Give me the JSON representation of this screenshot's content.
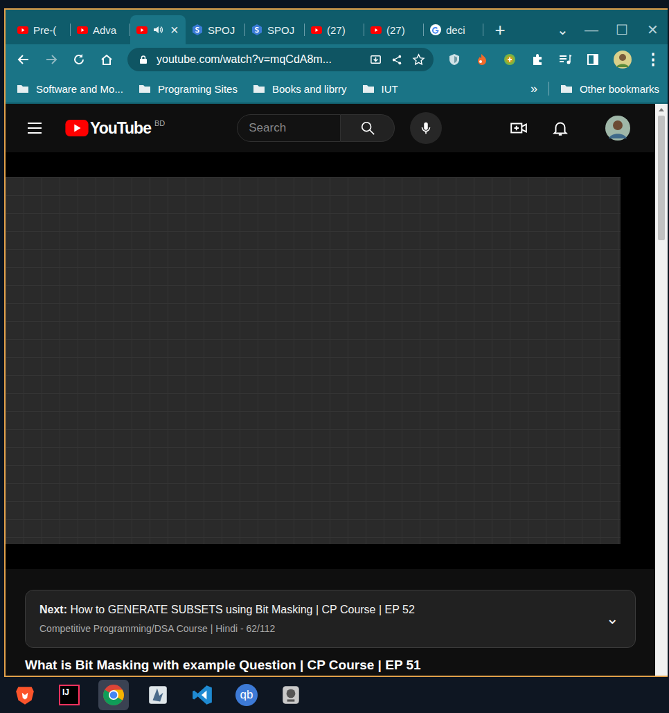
{
  "tabs": [
    {
      "label": "Pre-(",
      "icon": "youtube",
      "selected": false,
      "audio": false
    },
    {
      "label": "Adva",
      "icon": "youtube",
      "selected": false,
      "audio": false
    },
    {
      "label": "",
      "icon": "youtube",
      "selected": true,
      "audio": true
    },
    {
      "label": "SPOJ",
      "icon": "spoj",
      "selected": false,
      "audio": false
    },
    {
      "label": "SPOJ",
      "icon": "spoj",
      "selected": false,
      "audio": false
    },
    {
      "label": "(27)",
      "icon": "youtube",
      "selected": false,
      "audio": false
    },
    {
      "label": "(27)",
      "icon": "youtube",
      "selected": false,
      "audio": false
    },
    {
      "label": "deci",
      "icon": "google",
      "selected": false,
      "audio": false
    }
  ],
  "tab_close": "×",
  "tab_controls": {
    "new_tab": "+",
    "dropdown": "⌄",
    "minimize": "—",
    "maximize": "☐",
    "close": "✕"
  },
  "address": {
    "url": "youtube.com/watch?v=mqCdA8m..."
  },
  "menu": "⋮",
  "bookmarks": [
    "Software and Mo...",
    "Programing Sites",
    "Books and librry",
    "IUT"
  ],
  "bookmarks_overflow": "»",
  "other_bookmarks": "Other bookmarks",
  "youtube": {
    "logo": "YouTube",
    "region": "BD",
    "search_placeholder": "Search"
  },
  "up_next": {
    "label": "Next:",
    "title": "How to GENERATE SUBSETS using Bit Masking | CP Course | EP 52",
    "playlist": "Competitive Programming/DSA Course | Hindi - 62/112",
    "chevron": "⌄"
  },
  "video_title": "What is Bit Masking with example Question | CP Course | EP 51",
  "taskbar": [
    {
      "kind": "brave",
      "label": "",
      "selected": false
    },
    {
      "kind": "intellij",
      "label": "IJ",
      "selected": false
    },
    {
      "kind": "chrome",
      "label": "",
      "selected": true
    },
    {
      "kind": "app",
      "label": "",
      "selected": false
    },
    {
      "kind": "vscode",
      "label": "",
      "selected": false
    },
    {
      "kind": "qbittorrent",
      "label": "qb",
      "selected": false
    },
    {
      "kind": "tool",
      "label": "",
      "selected": false
    }
  ]
}
